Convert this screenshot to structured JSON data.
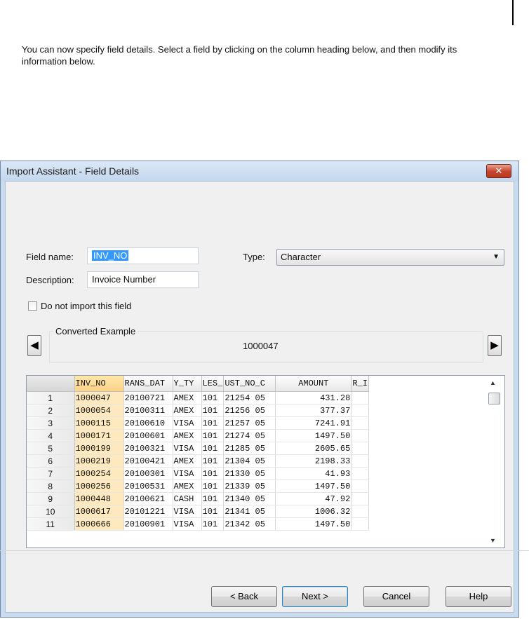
{
  "dialog": {
    "title": "Import Assistant - Field Details",
    "close_label": "✕",
    "intro": "You can now specify field details. Select a field by clicking on the column heading below, and then modify its information below.",
    "field_name_label": "Field name:",
    "field_name_value": "INV_NO",
    "type_label": "Type:",
    "type_value": "Character",
    "description_label": "Description:",
    "description_value": "Invoice Number",
    "do_not_import_label": "Do not import this field",
    "do_not_import_checked": false,
    "converted_example_label": "Converted Example",
    "converted_example_value": "1000047",
    "prev_label": "◀",
    "next_arrow_label": "▶"
  },
  "grid": {
    "columns": [
      "INV_NO",
      "RANS_DAT",
      "Y_TY",
      "LES_",
      "UST_NO_C",
      "AMOUNT",
      "R_I"
    ],
    "rows": [
      {
        "n": "1",
        "c": [
          "1000047",
          "20100721",
          "AMEX",
          "101",
          "21254 05",
          "431.28",
          ""
        ]
      },
      {
        "n": "2",
        "c": [
          "1000054",
          "20100311",
          "AMEX",
          "101",
          "21256 05",
          "377.37",
          ""
        ]
      },
      {
        "n": "3",
        "c": [
          "1000115",
          "20100610",
          "VISA",
          "101",
          "21257 05",
          "7241.91",
          ""
        ]
      },
      {
        "n": "4",
        "c": [
          "1000171",
          "20100601",
          "AMEX",
          "101",
          "21274 05",
          "1497.50",
          ""
        ]
      },
      {
        "n": "5",
        "c": [
          "1000199",
          "20100321",
          "VISA",
          "101",
          "21285 05",
          "2605.65",
          ""
        ]
      },
      {
        "n": "6",
        "c": [
          "1000219",
          "20100421",
          "AMEX",
          "101",
          "21304 05",
          "2198.33",
          ""
        ]
      },
      {
        "n": "7",
        "c": [
          "1000254",
          "20100301",
          "VISA",
          "101",
          "21330 05",
          "41.93",
          ""
        ]
      },
      {
        "n": "8",
        "c": [
          "1000256",
          "20100531",
          "AMEX",
          "101",
          "21339 05",
          "1497.50",
          ""
        ]
      },
      {
        "n": "9",
        "c": [
          "1000448",
          "20100621",
          "CASH",
          "101",
          "21340 05",
          "47.92",
          ""
        ]
      },
      {
        "n": "10",
        "c": [
          "1000617",
          "20101221",
          "VISA",
          "101",
          "21341 05",
          "1006.32",
          ""
        ]
      },
      {
        "n": "11",
        "c": [
          "1000666",
          "20100901",
          "VISA",
          "101",
          "21342 05",
          "1497.50",
          ""
        ]
      }
    ],
    "scroll_up": "▲",
    "scroll_down": "▼"
  },
  "buttons": {
    "back": "< Back",
    "next": "Next >",
    "cancel": "Cancel",
    "help": "Help"
  }
}
